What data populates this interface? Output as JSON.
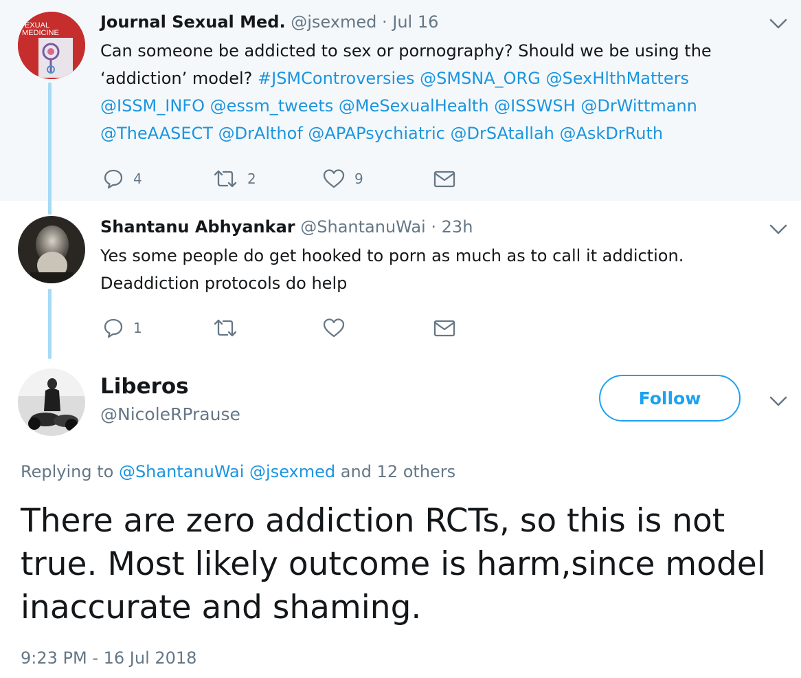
{
  "tweets": [
    {
      "name": "Journal Sexual Med.",
      "handle": "@jsexmed",
      "time": "Jul 16",
      "text_lines": [
        [
          {
            "t": "Can someone be addicted to sex or pornography? Should we be using the",
            "m": false
          }
        ],
        [
          {
            "t": "‘addiction’ model? ",
            "m": false
          },
          {
            "t": "#JSMControversies @SMSNA_ORG @SexHlthMatters",
            "m": true
          }
        ],
        [
          {
            "t": "@ISSM_INFO @essm_tweets @MeSexualHealth @ISSWSH @DrWittmann",
            "m": true
          }
        ],
        [
          {
            "t": "@TheAASECT @DrAlthof @APAPsychiatric @DrSAtallah @AskDrRuth",
            "m": true
          }
        ]
      ],
      "replies": "4",
      "retweets": "2",
      "likes": "9",
      "avatar_text": "EXUAL\nMEDICINE"
    },
    {
      "name": "Shantanu Abhyankar",
      "handle": "@ShantanuWai",
      "time": "23h",
      "text_lines": [
        [
          {
            "t": "Yes some people do get hooked to porn as much as to call it addiction.",
            "m": false
          }
        ],
        [
          {
            "t": "Deaddiction protocols do help",
            "m": false
          }
        ]
      ],
      "replies": "1",
      "retweets": "",
      "likes": ""
    }
  ],
  "main_tweet": {
    "name": "Liberos",
    "handle": "@NicoleRPrause",
    "follow_label": "Follow",
    "replying_prefix": "Replying to ",
    "replying_mentions": "@ShantanuWai @jsexmed",
    "replying_suffix": " and 12 others",
    "text": "There are zero addiction RCTs, so this is not true. Most likely outcome is harm,since model inaccurate and shaming.",
    "timestamp": "9:23 PM - 16 Jul 2018"
  },
  "colors": {
    "accent": "#1da1f2",
    "mention": "#1b95e0",
    "muted": "#657786",
    "thread_line": "#a5dbf6",
    "highlight_bg": "#f5f8fa"
  },
  "icons": [
    "reply-icon",
    "retweet-icon",
    "like-icon",
    "dm-icon",
    "chevron-down-icon"
  ]
}
